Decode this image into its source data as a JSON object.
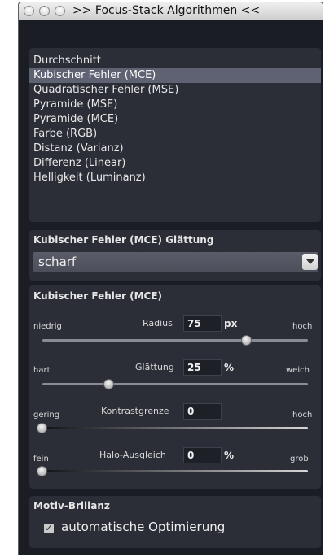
{
  "window": {
    "title": ">> Focus-Stack Algorithmen <<"
  },
  "algorithm_list": {
    "items": [
      "Durchschnitt",
      "Kubischer Fehler (MCE)",
      "Quadratischer Fehler (MSE)",
      "Pyramide (MSE)",
      "Pyramide (MCE)",
      "Farbe (RGB)",
      "Distanz (Varianz)",
      "Differenz (Linear)",
      "Helligkeit (Luminanz)"
    ],
    "selected": "Kubischer Fehler (MCE)"
  },
  "smoothing": {
    "header": "Kubischer Fehler (MCE) Glättung",
    "value": "scharf"
  },
  "params": {
    "header": "Kubischer Fehler (MCE)",
    "radius": {
      "low": "niedrig",
      "label": "Radius",
      "value": "75",
      "unit": "px",
      "high": "hoch",
      "level": 0.77
    },
    "smooth": {
      "low": "hart",
      "label": "Glättung",
      "value": "25",
      "unit": "%",
      "high": "weich",
      "level": 0.25
    },
    "contrast": {
      "low": "gering",
      "label": "Kontrastgrenze",
      "value": "0",
      "unit": "",
      "high": "hoch",
      "level": 0.0
    },
    "halo": {
      "low": "fein",
      "label": "Halo-Ausgleich",
      "value": "0",
      "unit": "%",
      "high": "grob",
      "level": 0.0
    }
  },
  "motiv": {
    "header": "Motiv-Brillanz",
    "checkbox_label": "automatische Optimierung",
    "checked": true
  },
  "colors": {
    "background": "#1b1d24",
    "panel": "#2b2e37",
    "selection": "#5f6273"
  }
}
